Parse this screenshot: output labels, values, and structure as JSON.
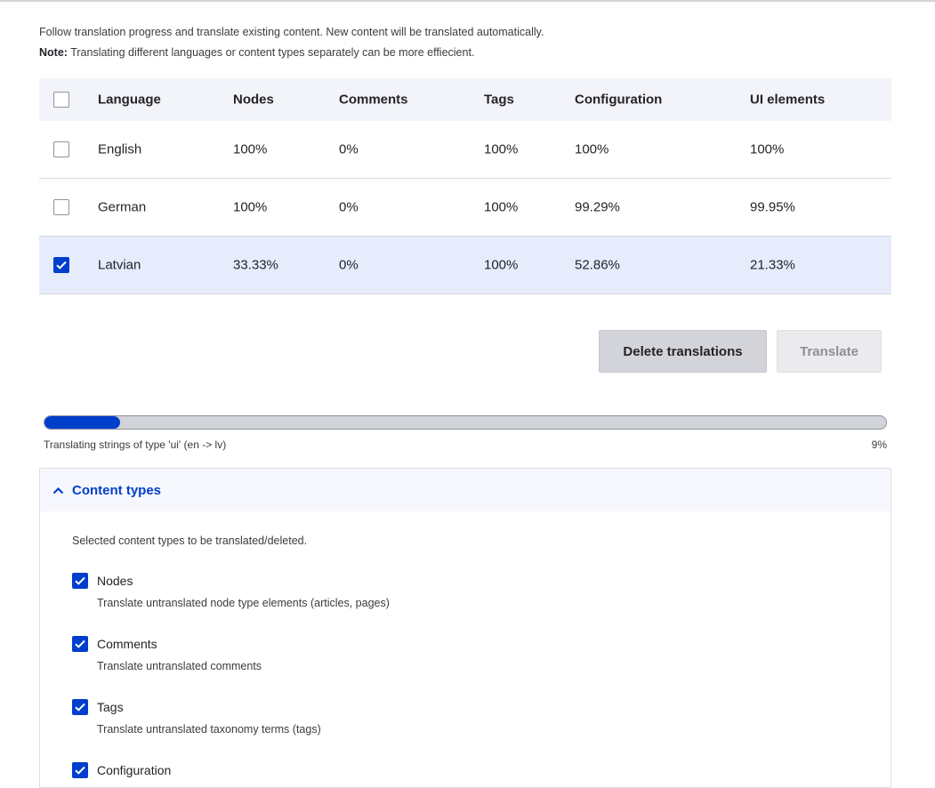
{
  "intro": {
    "line1": "Follow translation progress and translate existing content. New content will be translated automatically.",
    "note_label": "Note:",
    "note_text": " Translating different languages or content types separately can be more effiecient."
  },
  "table": {
    "headers": [
      "Language",
      "Nodes",
      "Comments",
      "Tags",
      "Configuration",
      "UI elements"
    ],
    "rows": [
      {
        "language": "English",
        "nodes": "100%",
        "comments": "0%",
        "tags": "100%",
        "configuration": "100%",
        "ui": "100%",
        "checked": false
      },
      {
        "language": "German",
        "nodes": "100%",
        "comments": "0%",
        "tags": "100%",
        "configuration": "99.29%",
        "ui": "99.95%",
        "checked": false
      },
      {
        "language": "Latvian",
        "nodes": "33.33%",
        "comments": "0%",
        "tags": "100%",
        "configuration": "52.86%",
        "ui": "21.33%",
        "checked": true
      }
    ]
  },
  "actions": {
    "delete_label": "Delete translations",
    "translate_label": "Translate"
  },
  "progress": {
    "label": "Translating strings of type 'ui' (en -> lv)",
    "percent_text": "9%",
    "value": 0.09
  },
  "panel": {
    "title": "Content types",
    "description": "Selected content types to be translated/deleted.",
    "options": [
      {
        "label": "Nodes",
        "description": "Translate untranslated node type elements (articles, pages)",
        "checked": true
      },
      {
        "label": "Comments",
        "description": "Translate untranslated comments",
        "checked": true
      },
      {
        "label": "Tags",
        "description": "Translate untranslated taxonomy terms (tags)",
        "checked": true
      },
      {
        "label": "Configuration",
        "description": "",
        "checked": true
      }
    ]
  },
  "colors": {
    "accent": "#003ecc",
    "selected_row": "#e6ecfc",
    "header_bg": "#f3f4f9"
  },
  "icons": {
    "checkbox_checked": "check-icon",
    "panel_toggle": "chevron-up-icon"
  }
}
